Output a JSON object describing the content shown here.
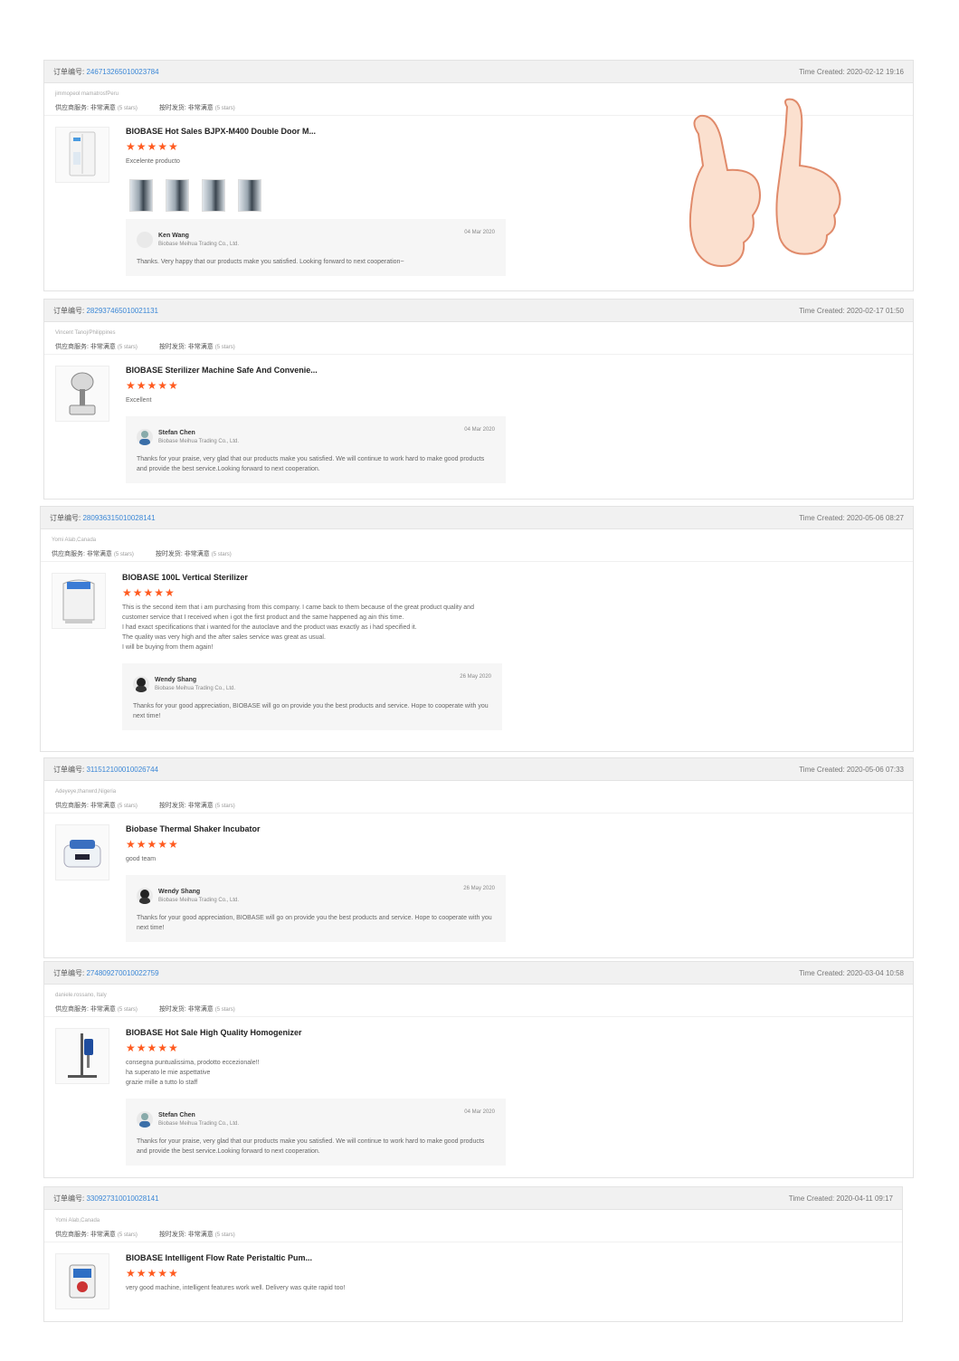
{
  "order_no_label": "订单编号:",
  "created_label": "Time Created:",
  "supplier_label": "供应商服务: 非常满意",
  "shipping_label": "按时发货: 非常满意",
  "five_stars": "(5 stars)",
  "stars_glyph": "★★★★★",
  "accent_color": "#ff5a1f",
  "link_color": "#3b87d6",
  "orders": [
    {
      "order_no": "246713265010023784",
      "created": "2020-02-12 19:16",
      "buyer": "jimmopeol mamatrosfPeru",
      "title": "BIOBASE Hot Sales BJPX-M400 Double Door M...",
      "review": "Excelente producto",
      "reply_name": "Ken Wang",
      "reply_company": "Biobase Meihua Trading Co., Ltd.",
      "reply_date": "04 Mar 2020",
      "reply_text": "Thanks. Very happy that our products make you satisfied. Looking forward to next cooperation~"
    },
    {
      "order_no": "282937465010021131",
      "created": "2020-02-17 01:50",
      "buyer": "Vincent Tanoj/Philippines",
      "title": "BIOBASE Sterilizer Machine Safe And Convenie...",
      "review": "Excellent",
      "reply_name": "Stefan Chen",
      "reply_company": "Biobase Meihua Trading Co., Ltd.",
      "reply_date": "04 Mar 2020",
      "reply_text": "Thanks for your praise, very glad that our products make you satisfied. We will continue to work hard to make good products and provide the best service.Looking forward to next cooperation."
    },
    {
      "order_no": "280936315010028141",
      "created": "2020-05-06 08:27",
      "buyer": "Yomi Alab,Canada",
      "title": "BIOBASE 100L Vertical Sterilizer",
      "review": "This is the second item that i am purchasing from this company. I came back to them because of the great product quality and customer service that I received when i got the first product and the same happened ag ain this time.\nI had exact specifications that i wanted for the autoclave and the product was exactly as i had specified it.\nThe quality was very high and the after sales service was great as usual.\nI will be buying from them again!",
      "reply_name": "Wendy Shang",
      "reply_company": "Biobase Meihua Trading Co., Ltd.",
      "reply_date": "26 May 2020",
      "reply_text": "Thanks for your good appreciation, BIOBASE will go on provide you the best products and service. Hope to cooperate with you next time!"
    },
    {
      "order_no": "311512100010026744",
      "created": "2020-05-06 07:33",
      "buyer": "Adeyeye,thanwrd,Nigeria",
      "title": "Biobase Thermal Shaker Incubator",
      "review": "good team",
      "reply_name": "Wendy Shang",
      "reply_company": "Biobase Meihua Trading Co., Ltd.",
      "reply_date": "26 May 2020",
      "reply_text": "Thanks for your good appreciation, BIOBASE will go on provide you the best products and service. Hope to cooperate with you next time!"
    },
    {
      "order_no": "274809270010022759",
      "created": "2020-03-04 10:58",
      "buyer": "daniele.rossano, Italy",
      "title": "BIOBASE Hot Sale High Quality Homogenizer",
      "review": "consegna puntualissima, prodotto eccezionale!!\nha superato le mie aspettative\ngrazie mille a tutto lo staff",
      "reply_name": "Stefan Chen",
      "reply_company": "Biobase Meihua Trading Co., Ltd.",
      "reply_date": "04 Mar 2020",
      "reply_text": "Thanks for your praise, very glad that our products make you satisfied. We will continue to work hard to make good products and provide the best service.Looking forward to next cooperation."
    },
    {
      "order_no": "330927310010028141",
      "created": "2020-04-11 09:17",
      "buyer": "Yomi Alab,Canada",
      "title": "BIOBASE Intelligent Flow Rate Peristaltic Pum...",
      "review": "very good machine, intelligent features work well. Delivery was quite rapid too!"
    }
  ]
}
